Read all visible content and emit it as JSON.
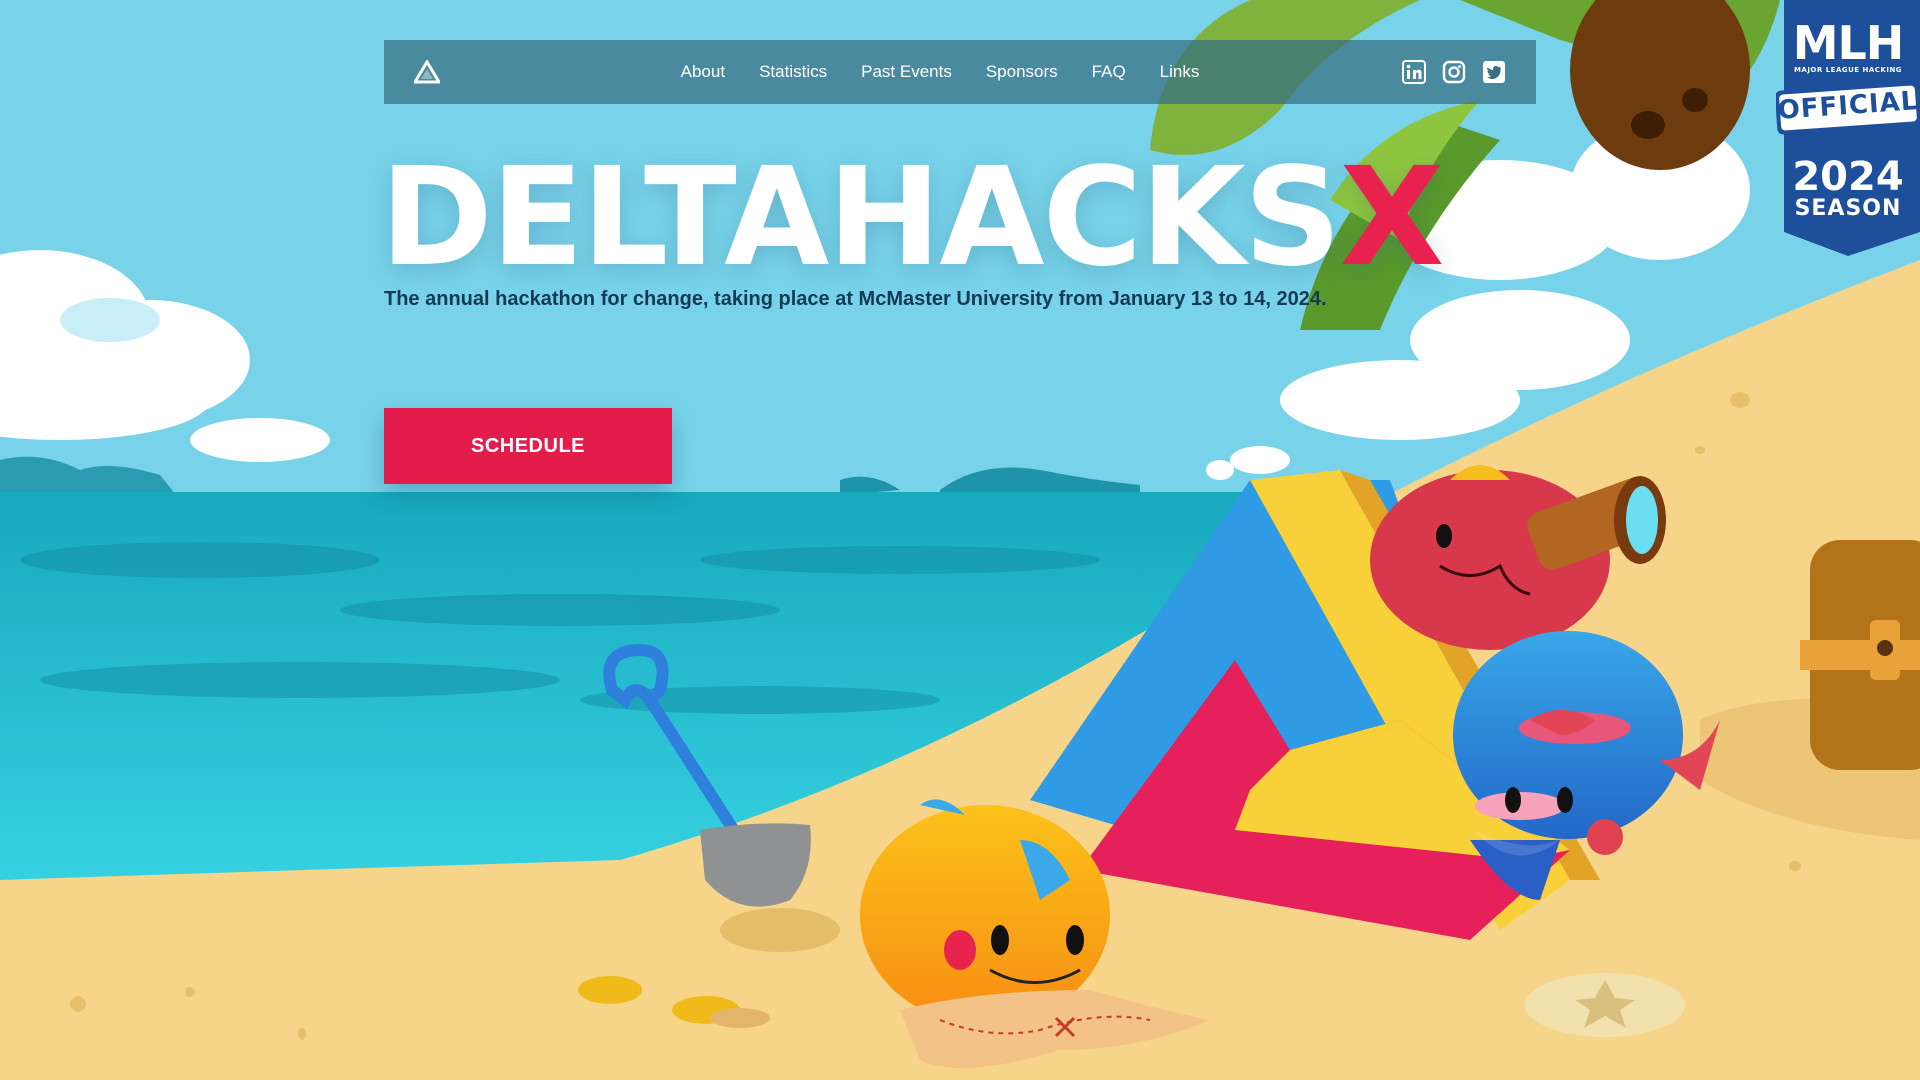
{
  "colors": {
    "sky": "#78d3ea",
    "sea": "#19b2c8",
    "sand": "#f6d58a",
    "accent": "#e31c4c",
    "navbar": "#376e82",
    "badge": "#1e4f9a"
  },
  "nav": {
    "logo_icon": "deltahacks-triangle-icon",
    "links": [
      "About",
      "Statistics",
      "Past Events",
      "Sponsors",
      "FAQ",
      "Links"
    ],
    "social_icons": [
      "linkedin-icon",
      "instagram-icon",
      "twitter-icon"
    ]
  },
  "hero": {
    "title": "DELTAHACKS",
    "title_accent": "X",
    "subtitle": "The annual hackathon for change, taking place at McMaster University from January 13 to 14, 2024.",
    "cta_label": "SCHEDULE"
  },
  "mlh_badge": {
    "line1": "MLH",
    "line2": "MAJOR LEAGUE HACKING",
    "line3": "OFFICIAL",
    "line4": "2024",
    "line5": "SEASON"
  }
}
